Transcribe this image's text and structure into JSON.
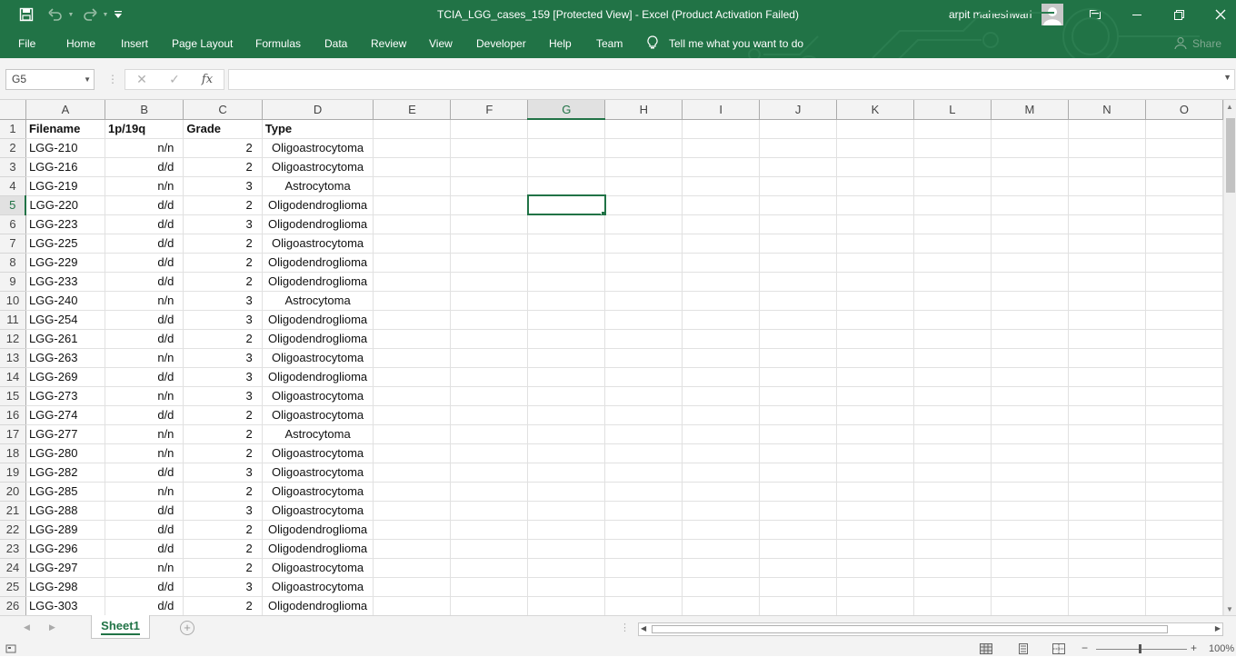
{
  "window": {
    "title": "TCIA_LGG_cases_159  [Protected View]  -  Excel (Product Activation Failed)",
    "user": "arpit maheshwari"
  },
  "ribbon": {
    "tabs": [
      "File",
      "Home",
      "Insert",
      "Page Layout",
      "Formulas",
      "Data",
      "Review",
      "View",
      "Developer",
      "Help",
      "Team"
    ],
    "tell_me": "Tell me what you want to do",
    "share": "Share"
  },
  "formula_bar": {
    "name_box": "G5",
    "fx_label": "fx",
    "value": ""
  },
  "grid": {
    "columns": [
      "A",
      "B",
      "C",
      "D",
      "E",
      "F",
      "G",
      "H",
      "I",
      "J",
      "K",
      "L",
      "M",
      "N",
      "O"
    ],
    "selected_column": "G",
    "selected_row": 5,
    "header": [
      "Filename",
      "1p/19q",
      "Grade",
      "Type"
    ],
    "rows": [
      [
        "LGG-210",
        "n/n",
        "2",
        "Oligoastrocytoma"
      ],
      [
        "LGG-216",
        "d/d",
        "2",
        "Oligoastrocytoma"
      ],
      [
        "LGG-219",
        "n/n",
        "3",
        "Astrocytoma"
      ],
      [
        "LGG-220",
        "d/d",
        "2",
        "Oligodendroglioma"
      ],
      [
        "LGG-223",
        "d/d",
        "3",
        "Oligodendroglioma"
      ],
      [
        "LGG-225",
        "d/d",
        "2",
        "Oligoastrocytoma"
      ],
      [
        "LGG-229",
        "d/d",
        "2",
        "Oligodendroglioma"
      ],
      [
        "LGG-233",
        "d/d",
        "2",
        "Oligodendroglioma"
      ],
      [
        "LGG-240",
        "n/n",
        "3",
        "Astrocytoma"
      ],
      [
        "LGG-254",
        "d/d",
        "3",
        "Oligodendroglioma"
      ],
      [
        "LGG-261",
        "d/d",
        "2",
        "Oligodendroglioma"
      ],
      [
        "LGG-263",
        "n/n",
        "3",
        "Oligoastrocytoma"
      ],
      [
        "LGG-269",
        "d/d",
        "3",
        "Oligodendroglioma"
      ],
      [
        "LGG-273",
        "n/n",
        "3",
        "Oligoastrocytoma"
      ],
      [
        "LGG-274",
        "d/d",
        "2",
        "Oligoastrocytoma"
      ],
      [
        "LGG-277",
        "n/n",
        "2",
        "Astrocytoma"
      ],
      [
        "LGG-280",
        "n/n",
        "2",
        "Oligoastrocytoma"
      ],
      [
        "LGG-282",
        "d/d",
        "3",
        "Oligoastrocytoma"
      ],
      [
        "LGG-285",
        "n/n",
        "2",
        "Oligoastrocytoma"
      ],
      [
        "LGG-288",
        "d/d",
        "3",
        "Oligoastrocytoma"
      ],
      [
        "LGG-289",
        "d/d",
        "2",
        "Oligodendroglioma"
      ],
      [
        "LGG-296",
        "d/d",
        "2",
        "Oligodendroglioma"
      ],
      [
        "LGG-297",
        "n/n",
        "2",
        "Oligoastrocytoma"
      ],
      [
        "LGG-298",
        "d/d",
        "3",
        "Oligoastrocytoma"
      ],
      [
        "LGG-303",
        "d/d",
        "2",
        "Oligodendroglioma"
      ]
    ]
  },
  "sheets": {
    "tabs": [
      "Sheet1"
    ],
    "active": "Sheet1"
  },
  "status": {
    "zoom": "100%"
  },
  "colors": {
    "accent": "#217346"
  }
}
